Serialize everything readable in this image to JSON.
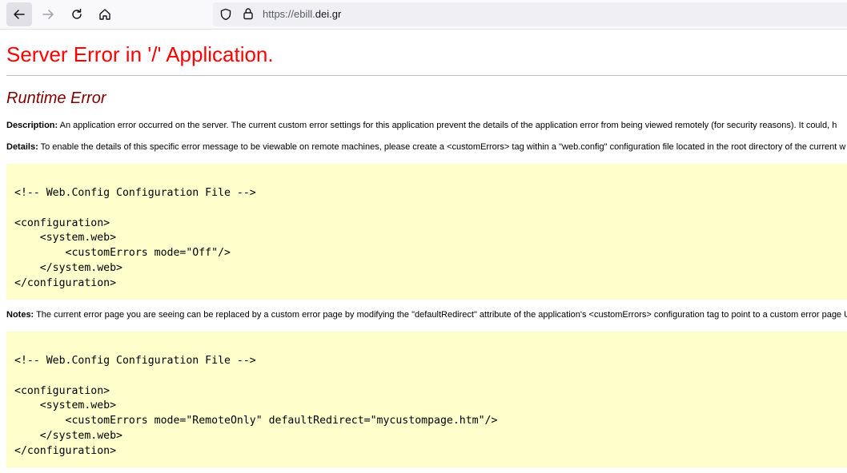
{
  "browser": {
    "url_prefix": "https://ebill.",
    "url_host": "dei.gr"
  },
  "page": {
    "title": "Server Error in '/' Application.",
    "subtitle": "Runtime Error",
    "description_label": "Description:",
    "description_text": " An application error occurred on the server. The current custom error settings for this application prevent the details of the application error from being viewed remotely (for security reasons). It could, h",
    "details_label": "Details:",
    "details_text": " To enable the details of this specific error message to be viewable on remote machines, please create a <customErrors> tag within a \"web.config\" configuration file located in the root directory of the current w",
    "code1": {
      "comment": "<!-- Web.Config Configuration File -->",
      "line1": "<configuration>",
      "line2": "    <system.web>",
      "line3": "        <customErrors mode=\"Off\"/>",
      "line4": "    </system.web>",
      "line5": "</configuration>"
    },
    "notes_label": "Notes:",
    "notes_text": " The current error page you are seeing can be replaced by a custom error page by modifying the \"defaultRedirect\" attribute of the application's <customErrors> configuration tag to point to a custom error page U",
    "code2": {
      "comment": "<!-- Web.Config Configuration File -->",
      "line1": "<configuration>",
      "line2": "    <system.web>",
      "line3": "        <customErrors mode=\"RemoteOnly\" defaultRedirect=\"mycustompage.htm\"/>",
      "line4": "    </system.web>",
      "line5": "</configuration>"
    }
  },
  "icons": [
    "back-arrow-icon",
    "forward-arrow-icon",
    "reload-icon",
    "home-icon",
    "shield-icon",
    "lock-icon"
  ],
  "colors": {
    "title": "#ff0000",
    "subtitle": "#800000",
    "code_background": "#ffffcc"
  }
}
